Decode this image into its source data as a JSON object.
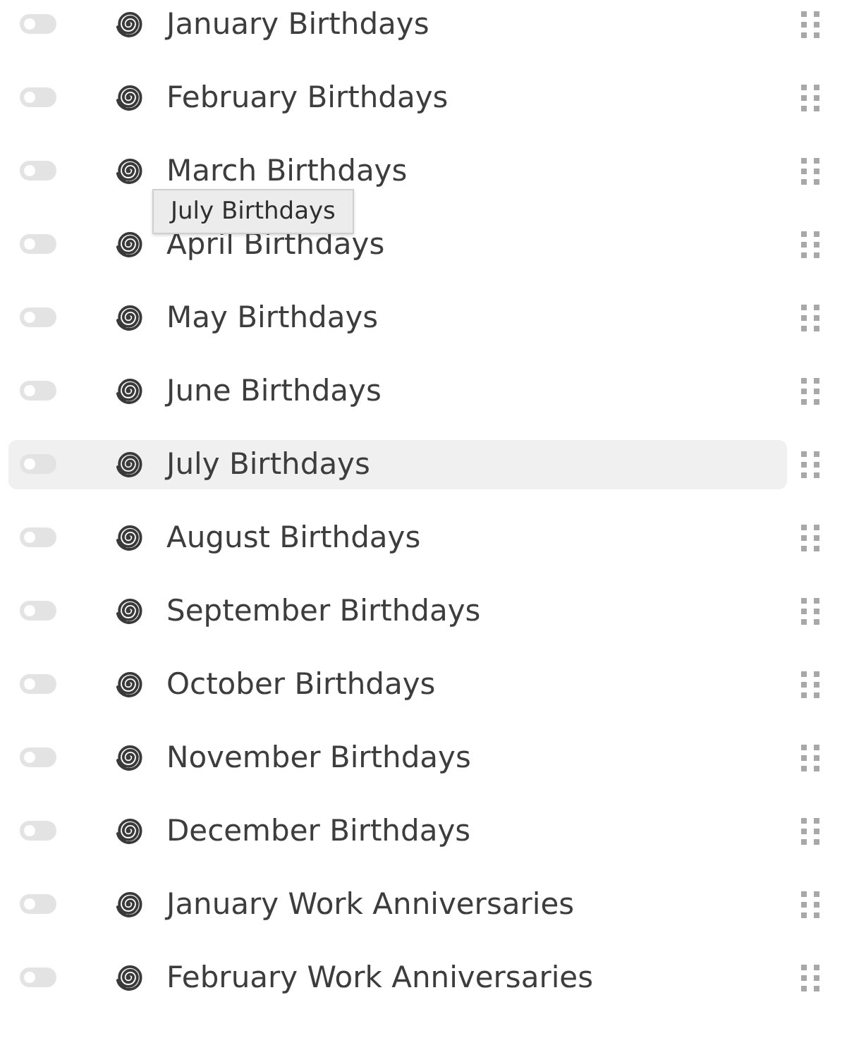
{
  "items": [
    {
      "label": "January Birthdays",
      "on": false,
      "selected": false
    },
    {
      "label": "February Birthdays",
      "on": false,
      "selected": false
    },
    {
      "label": "March Birthdays",
      "on": false,
      "selected": false
    },
    {
      "label": "April Birthdays",
      "on": false,
      "selected": false
    },
    {
      "label": "May Birthdays",
      "on": false,
      "selected": false
    },
    {
      "label": "June Birthdays",
      "on": false,
      "selected": false
    },
    {
      "label": "July Birthdays",
      "on": false,
      "selected": true
    },
    {
      "label": "August Birthdays",
      "on": false,
      "selected": false
    },
    {
      "label": "September Birthdays",
      "on": false,
      "selected": false
    },
    {
      "label": "October Birthdays",
      "on": false,
      "selected": false
    },
    {
      "label": "November Birthdays",
      "on": false,
      "selected": false
    },
    {
      "label": "December Birthdays",
      "on": false,
      "selected": false
    },
    {
      "label": "January Work Anniversaries",
      "on": false,
      "selected": false
    },
    {
      "label": "February Work Anniversaries",
      "on": false,
      "selected": false
    }
  ],
  "tooltip": {
    "text": "July Birthdays"
  }
}
